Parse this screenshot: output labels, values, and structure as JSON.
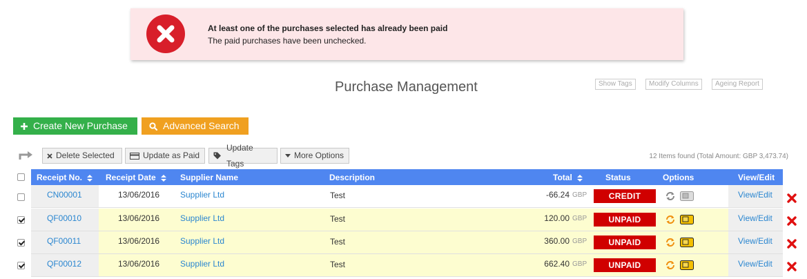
{
  "alert": {
    "title": "At least one of the purchases selected has already been paid",
    "message": "The paid purchases have been unchecked."
  },
  "page_title": "Purchase Management",
  "top_links": [
    "Show Tags",
    "Modify Columns",
    "Ageing Report"
  ],
  "actions": {
    "create": "Create New Purchase",
    "search": "Advanced Search"
  },
  "toolbar": {
    "delete": "Delete Selected",
    "update_paid": "Update as Paid",
    "update_tags": "Update Tags",
    "more": "More Options",
    "items_found": "12 Items found (Total Amount: GBP 3,473.74)"
  },
  "table": {
    "headers": [
      "Receipt No.",
      "Receipt Date",
      "Supplier Name",
      "Description",
      "Total",
      "Status",
      "Options",
      "View/Edit"
    ],
    "rows": [
      {
        "no": "CN00001",
        "date": "13/06/2016",
        "supplier": "Supplier Ltd",
        "desc": "Test",
        "total": "-66.24",
        "currency": "GBP",
        "status": "CREDIT",
        "view": "View/Edit",
        "checked": false
      },
      {
        "no": "QF00010",
        "date": "13/06/2016",
        "supplier": "Supplier Ltd",
        "desc": "Test",
        "total": "120.00",
        "currency": "GBP",
        "status": "UNPAID",
        "view": "View/Edit",
        "checked": true
      },
      {
        "no": "QF00011",
        "date": "13/06/2016",
        "supplier": "Supplier Ltd",
        "desc": "Test",
        "total": "360.00",
        "currency": "GBP",
        "status": "UNPAID",
        "view": "View/Edit",
        "checked": true
      },
      {
        "no": "QF00012",
        "date": "13/06/2016",
        "supplier": "Supplier Ltd",
        "desc": "Test",
        "total": "662.40",
        "currency": "GBP",
        "status": "UNPAID",
        "view": "View/Edit",
        "checked": true
      }
    ]
  },
  "colors": {
    "header_blue": "#4f86f0",
    "status_red": "#d00000",
    "link_blue": "#2a86d0",
    "green": "#34b04a",
    "orange": "#f0a020",
    "alert_bg": "#fde6e8"
  }
}
